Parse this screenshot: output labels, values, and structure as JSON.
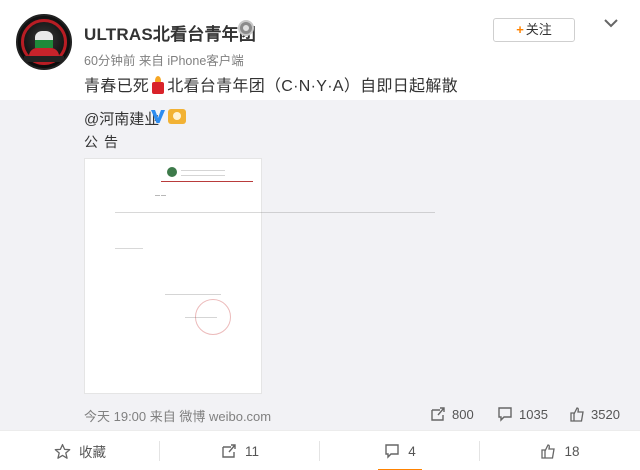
{
  "post": {
    "username": "ULTRAS北看台青年团",
    "meta": "60分钟前 来自 iPhone客户端",
    "follow_label": "关注",
    "text_before_emoji": "青春已死",
    "text_after_emoji": "北看台青年团（C·N·Y·A）自即日起解散"
  },
  "repost": {
    "author": "@河南建业",
    "text": "公告",
    "time_source": "今天 19:00 来自 微博 weibo.com",
    "stats": {
      "reposts": "800",
      "comments": "1035",
      "likes": "3520"
    }
  },
  "actions": {
    "favorite": "收藏",
    "repost": "11",
    "comment": "4",
    "like": "18"
  },
  "colors": {
    "accent": "#ff8200",
    "verified": "#2d8cf0",
    "repost_bg": "#f2f2f5",
    "meta_text": "#808080"
  },
  "icons": {
    "avatar": "ultras-avatar",
    "badge": "member-badge-icon",
    "verified": "verified-v-icon",
    "chevron": "chevron-down-icon",
    "repost": "share-icon",
    "comment": "comment-icon",
    "like": "thumbs-up-icon",
    "favorite": "star-icon"
  }
}
